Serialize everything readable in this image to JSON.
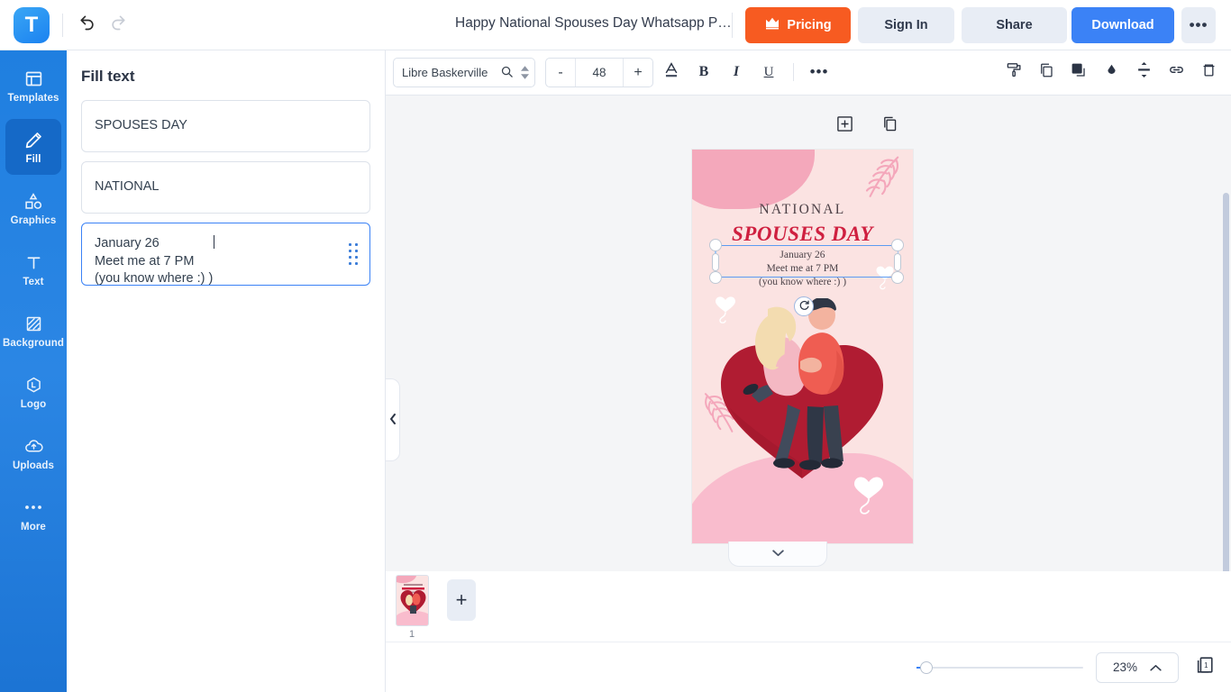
{
  "topbar": {
    "logo_letter": "T",
    "undo_icon": "undo-icon",
    "redo_icon": "redo-icon",
    "doc_title": "Happy National Spouses Day Whatsapp P…",
    "pricing_label": "Pricing",
    "signin_label": "Sign In",
    "share_label": "Share",
    "download_label": "Download",
    "more_label": "•••",
    "pricing_color": "#f75b21",
    "download_color": "#3b82f6"
  },
  "rail": {
    "items": [
      {
        "label": "Templates",
        "icon": "templates-icon",
        "active": false
      },
      {
        "label": "Fill",
        "icon": "pencil-icon",
        "active": true
      },
      {
        "label": "Graphics",
        "icon": "shapes-icon",
        "active": false
      },
      {
        "label": "Text",
        "icon": "text-icon",
        "active": false
      },
      {
        "label": "Background",
        "icon": "background-icon",
        "active": false
      },
      {
        "label": "Logo",
        "icon": "logo-icon",
        "active": false
      },
      {
        "label": "Uploads",
        "icon": "upload-cloud-icon",
        "active": false
      },
      {
        "label": "More",
        "icon": "ellipsis-icon",
        "active": false
      }
    ]
  },
  "panel": {
    "title": "Fill text",
    "fields": [
      {
        "value": "SPOUSES DAY",
        "active": false
      },
      {
        "value": "NATIONAL",
        "active": false
      },
      {
        "value": "January 26\nMeet me at 7 PM\n(you know where :) )",
        "active": true
      }
    ],
    "collapse_icon": "chevron-left-icon"
  },
  "toolbar": {
    "font_name": "Libre Baskerville",
    "search_icon": "search-icon",
    "spinner_icon": "spinner-arrows-icon",
    "decrease_label": "-",
    "font_size": "48",
    "increase_label": "+",
    "text_color_icon": "text-color-icon",
    "bold_label": "B",
    "italic_label": "I",
    "underline_label": "U",
    "more_label": "•••",
    "right_tools": [
      "paint-roller-icon",
      "duplicate-icon",
      "layers-icon",
      "opacity-droplet-icon",
      "align-icon",
      "link-icon",
      "trash-icon"
    ]
  },
  "canvas": {
    "page_tools": [
      "add-element-icon",
      "duplicate-page-icon"
    ],
    "bottom_chevron_icon": "chevron-down-icon",
    "design": {
      "heading_small": "NATIONAL",
      "heading_large": "SPOUSES DAY",
      "body_text": "January 26\nMeet me at 7 PM\n(you know where :) )",
      "rotate_icon": "rotate-handle-icon",
      "bg_color": "#fbe3e2",
      "accent_color": "#cf2040",
      "blob_color": "#f4a8bb",
      "heart_color": "#b01c32"
    }
  },
  "strip": {
    "thumb_number": "1",
    "add_page_label": "+"
  },
  "bottombar": {
    "zoom_value": "23%",
    "zoom_chevron_icon": "chevron-up-icon",
    "pages_icon": "pages-icon",
    "pages_count": "1"
  }
}
